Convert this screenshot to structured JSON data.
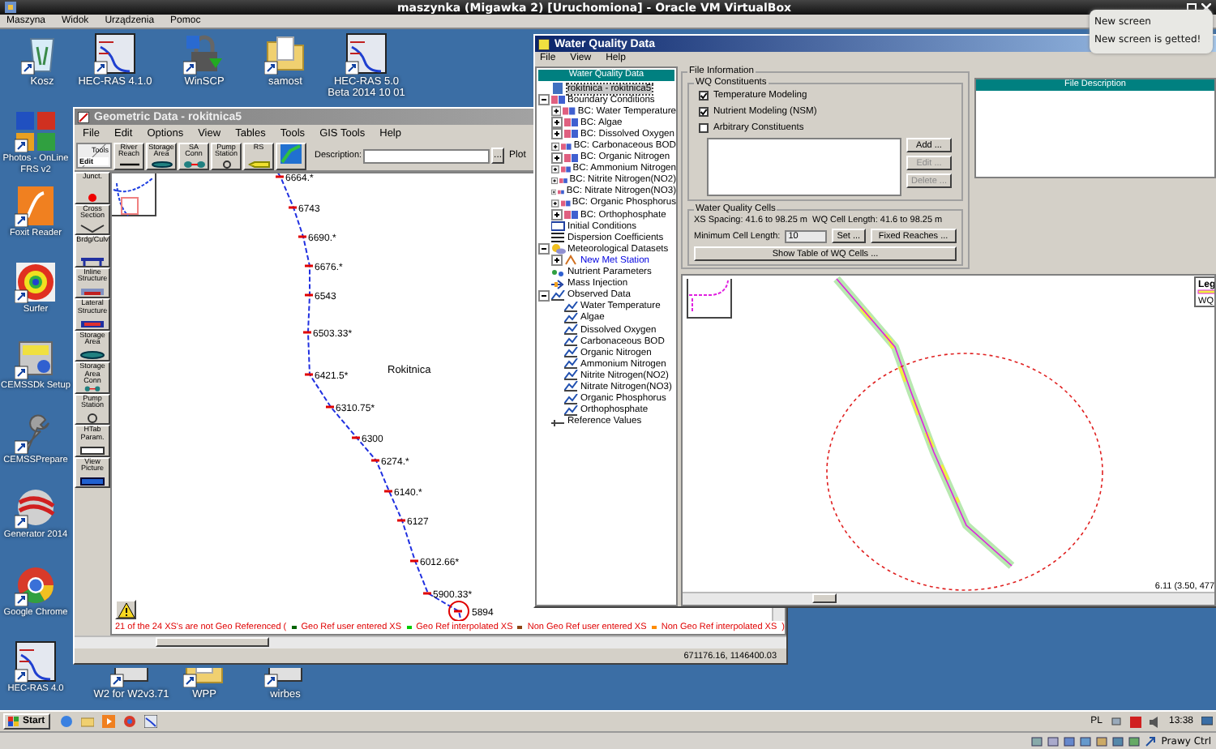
{
  "vm_window": {
    "title": "maszynka (Migawka 2) [Uruchomiona] - Oracle VM VirtualBox",
    "menu": [
      "Maszyna",
      "Widok",
      "Urządzenia",
      "Pomoc"
    ]
  },
  "notification": {
    "title": "New screen",
    "message": "New screen is getted!"
  },
  "desktop_icons": [
    {
      "label": "Kosz",
      "kind": "bin"
    },
    {
      "label": "HEC-RAS 4.1.0",
      "kind": "ras"
    },
    {
      "label": "WinSCP",
      "kind": "lock"
    },
    {
      "label": "samost",
      "kind": "folder"
    },
    {
      "label": "HEC-RAS 5.0 Beta 2014 10 01",
      "kind": "ras"
    },
    {
      "label": "Photos - OnLine FRS v2",
      "kind": "tiles"
    },
    {
      "label": "Foxit Reader",
      "kind": "pdf"
    },
    {
      "label": "Surfer",
      "kind": "contour"
    },
    {
      "label": "CEMSSDk Setup",
      "kind": "setup"
    },
    {
      "label": "CEMSSPrepare",
      "kind": "wrench"
    },
    {
      "label": "Generator 2014",
      "kind": "ring"
    },
    {
      "label": "Google Chrome",
      "kind": "chrome"
    },
    {
      "label": "HEC-RAS 4.0",
      "kind": "ras"
    },
    {
      "label": "W2 for W2v3.71",
      "kind": "app"
    },
    {
      "label": "WPP",
      "kind": "folder"
    },
    {
      "label": "wirbes",
      "kind": "app"
    }
  ],
  "geometric_data": {
    "title": "Geometric Data - rokitnica5",
    "menu": [
      "File",
      "Edit",
      "Options",
      "View",
      "Tables",
      "Tools",
      "GIS Tools",
      "Help"
    ],
    "corner": [
      {
        "label": "Tools",
        "selected": false
      },
      {
        "label": "Edit",
        "selected": true
      }
    ],
    "toolbar": [
      {
        "label": "River Reach",
        "kind": "reach"
      },
      {
        "label": "Storage Area",
        "kind": "area"
      },
      {
        "label": "SA Conn",
        "kind": "conn"
      },
      {
        "label": "Pump Station",
        "kind": "pump"
      },
      {
        "label": "RS",
        "kind": "rs"
      }
    ],
    "description_label": "Description:",
    "browse": "...",
    "plot": "Plot",
    "tools": [
      {
        "label": "Junct.",
        "kind": "junction"
      },
      {
        "label": "Cross Section",
        "kind": "xs"
      },
      {
        "label": "Brdg/Culv",
        "kind": "bridge"
      },
      {
        "label": "Inline Structure",
        "kind": "inline"
      },
      {
        "label": "Lateral Structure",
        "kind": "lateral"
      },
      {
        "label": "Storage Area",
        "kind": "area"
      },
      {
        "label": "Storage Area Conn",
        "kind": "conn"
      },
      {
        "label": "Pump Station",
        "kind": "pump"
      },
      {
        "label": "HTab Param.",
        "kind": "table"
      },
      {
        "label": "View Picture",
        "kind": "picture"
      }
    ],
    "river_label": "Rokitnica",
    "stations": [
      "6664.*",
      "6743",
      "6690.*",
      "6676.*",
      "6543",
      "6503.33*",
      "6421.5*",
      "6310.75*",
      "6300",
      "6274.*",
      "6140.*",
      "6127",
      "6012.66*",
      "5900.33*",
      "5894"
    ],
    "legend": {
      "note": "21 of the 24 XS's are not Geo Referenced (",
      "items": [
        {
          "label": "Geo Ref user entered XS",
          "color": "#006400"
        },
        {
          "label": "Geo Ref interpolated XS",
          "color": "#00cc00"
        },
        {
          "label": "Non Geo Ref user entered XS",
          "color": "#8b4513"
        },
        {
          "label": "Non Geo Ref interpolated XS",
          "color": "#ff8c00"
        }
      ],
      "close": ")"
    },
    "status": "671176.16, 1146400.03"
  },
  "water_quality": {
    "title": "Water Quality Data",
    "menu": [
      "File",
      "View",
      "Help"
    ],
    "tree_header": "Water Quality Data",
    "tree": [
      {
        "label": "rokitnica - rokitnica5",
        "kind": "project",
        "selected": true
      },
      {
        "label": "Boundary Conditions",
        "kind": "bc",
        "selected": false,
        "expanded": true,
        "children": [
          {
            "label": "BC: Water Temperature",
            "kind": "bc",
            "selected": false,
            "expanded": false
          },
          {
            "label": "BC: Algae",
            "kind": "bc",
            "selected": false,
            "expanded": false
          },
          {
            "label": "BC: Dissolved Oxygen",
            "kind": "bc",
            "selected": false,
            "expanded": false
          },
          {
            "label": "BC: Carbonaceous BOD",
            "kind": "bc",
            "selected": false,
            "expanded": false
          },
          {
            "label": "BC: Organic Nitrogen",
            "kind": "bc",
            "selected": false,
            "expanded": false
          },
          {
            "label": "BC: Ammonium Nitrogen",
            "kind": "bc",
            "selected": false,
            "expanded": false
          },
          {
            "label": "BC: Nitrite Nitrogen(NO2)",
            "kind": "bc",
            "selected": false,
            "expanded": false
          },
          {
            "label": "BC: Nitrate Nitrogen(NO3)",
            "kind": "bc",
            "selected": false,
            "expanded": false
          },
          {
            "label": "BC: Organic Phosphorus",
            "kind": "bc",
            "selected": false,
            "expanded": false
          },
          {
            "label": "BC: Orthophosphate",
            "kind": "bc",
            "selected": false,
            "expanded": false
          }
        ]
      },
      {
        "label": "Initial Conditions",
        "kind": "ic",
        "selected": false
      },
      {
        "label": "Dispersion Coefficients",
        "kind": "grid",
        "selected": false
      },
      {
        "label": "Meteorological Datasets",
        "kind": "met",
        "selected": false,
        "expanded": true,
        "children": [
          {
            "label": "New Met Station",
            "kind": "station",
            "selected": false,
            "expanded": false
          }
        ]
      },
      {
        "label": "Nutrient Parameters",
        "kind": "nutrient",
        "selected": false
      },
      {
        "label": "Mass Injection",
        "kind": "mass",
        "selected": false
      },
      {
        "label": "Observed Data",
        "kind": "observed",
        "selected": false,
        "expanded": true,
        "children": [
          {
            "label": "Water Temperature",
            "kind": "series",
            "selected": false
          },
          {
            "label": "Algae",
            "kind": "series",
            "selected": false
          },
          {
            "label": "Dissolved Oxygen",
            "kind": "series",
            "selected": false
          },
          {
            "label": "Carbonaceous BOD",
            "kind": "series",
            "selected": false
          },
          {
            "label": "Organic Nitrogen",
            "kind": "series",
            "selected": false
          },
          {
            "label": "Ammonium Nitrogen",
            "kind": "series",
            "selected": false
          },
          {
            "label": "Nitrite Nitrogen(NO2)",
            "kind": "series",
            "selected": false
          },
          {
            "label": "Nitrate Nitrogen(NO3)",
            "kind": "series",
            "selected": false
          },
          {
            "label": "Organic Phosphorus",
            "kind": "series",
            "selected": false
          },
          {
            "label": "Orthophosphate",
            "kind": "series",
            "selected": false
          }
        ]
      },
      {
        "label": "Reference Values",
        "kind": "reference",
        "selected": false
      }
    ],
    "file_info": "File Information",
    "constituents_title": "WQ Constituents",
    "constituents": [
      {
        "label": "Temperature Modeling",
        "checked": true
      },
      {
        "label": "Nutrient Modeling (NSM)",
        "checked": true
      },
      {
        "label": "Arbitrary Constituents",
        "checked": false
      }
    ],
    "buttons": [
      {
        "label": "Add ...",
        "disabled": false
      },
      {
        "label": "Edit ...",
        "disabled": true
      },
      {
        "label": "Delete ...",
        "disabled": true
      }
    ],
    "description_header": "File Description",
    "cells_title": "Water Quality Cells",
    "xs_spacing": "XS Spacing: 41.6 to 98.25 m",
    "cell_length": "WQ Cell Length: 41.6 to 98.25 m",
    "min_label": "Minimum Cell Length:",
    "min_value": "10",
    "set_button": "Set ...",
    "fixed_button": "Fixed Reaches ...",
    "table_button": "Show Table of WQ Cells ...",
    "map": {
      "legend_title": "Leg",
      "legend_item": "WQ",
      "coordinates": "6.11 (3.50, 477"
    }
  },
  "taskbar": {
    "start": "Start",
    "language": "PL",
    "clock": "13:38"
  },
  "vm_status": {
    "host_key": "Prawy Ctrl"
  }
}
